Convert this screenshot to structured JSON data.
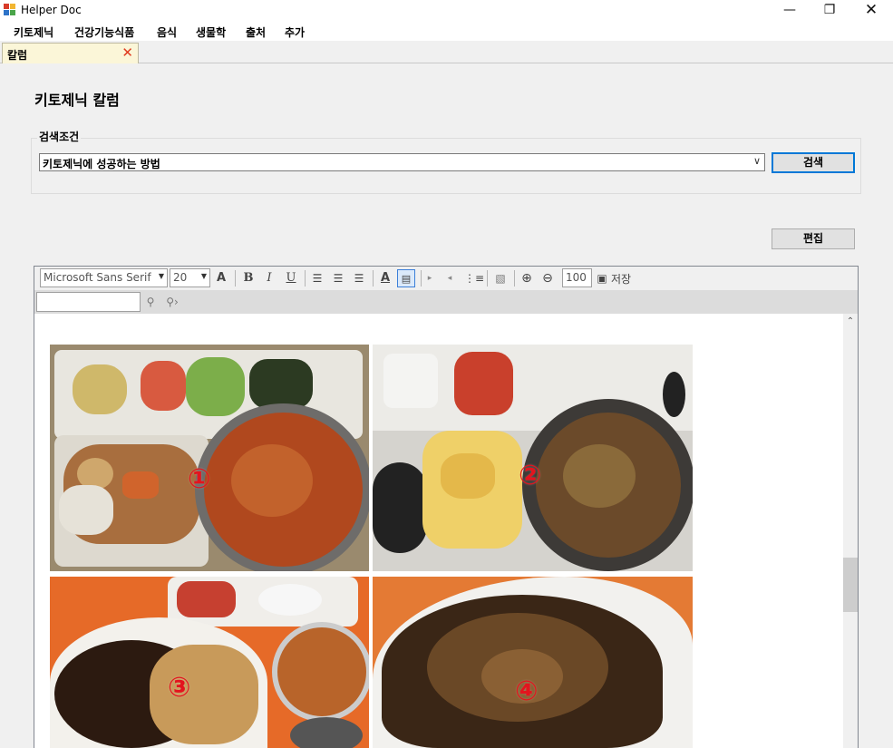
{
  "window": {
    "title": "Helper Doc",
    "minimize_icon": "minimize-icon",
    "restore_icon": "restore-icon",
    "close_icon": "close-icon"
  },
  "menu": {
    "items": [
      "키토제닉",
      "건강기능식품",
      "음식",
      "생물학",
      "출처",
      "추가"
    ]
  },
  "tab": {
    "label": "칼럼",
    "close_icon": "close-icon",
    "close_color": "#e03a1e"
  },
  "page": {
    "title": "키토제닉 칼럼"
  },
  "search": {
    "group_label": "검색조건",
    "selected_value": "키토제닉에 성공하는 방법",
    "button_label": "검색"
  },
  "edit_button": "편집",
  "toolbar": {
    "font_family": "Microsoft Sans Serif",
    "font_size": "20",
    "zoom": "100",
    "save_label": "저장",
    "icons": [
      "font-color-icon",
      "bold-icon",
      "italic-icon",
      "underline-icon",
      "align-left-icon",
      "align-center-icon",
      "align-right-icon",
      "text-color-icon",
      "highlight-icon",
      "indent-icon",
      "outdent-icon",
      "bullet-list-icon",
      "insert-image-icon",
      "zoom-in-icon",
      "zoom-out-icon",
      "save-icon",
      "find-icon",
      "find-next-icon"
    ]
  },
  "find": {
    "value": ""
  },
  "content": {
    "photo_labels": [
      "①",
      "②",
      "③",
      "④"
    ],
    "label_color": "#e3141e"
  }
}
